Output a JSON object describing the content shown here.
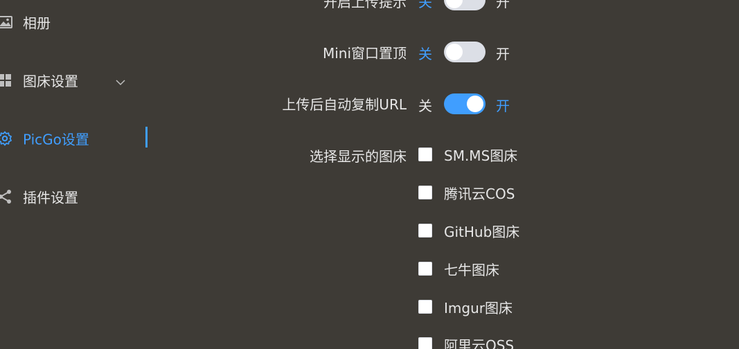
{
  "sidebar": {
    "items": [
      {
        "label": "相册",
        "icon": "image-icon"
      },
      {
        "label": "图床设置",
        "icon": "grid-icon"
      },
      {
        "label": "PicGo设置",
        "icon": "gear-icon"
      },
      {
        "label": "插件设置",
        "icon": "share-icon"
      }
    ]
  },
  "settings": {
    "upload_notice": {
      "label": "开启上传提示",
      "off": "关",
      "on": "开",
      "enabled": false
    },
    "mini_top": {
      "label": "Mini窗口置顶",
      "off": "关",
      "on": "开",
      "enabled": false
    },
    "auto_copy": {
      "label": "上传后自动复制URL",
      "off": "关",
      "on": "开",
      "enabled": true
    },
    "show_hosts": {
      "label": "选择显示的图床",
      "options": [
        "SM.MS图床",
        "腾讯云COS",
        "GitHub图床",
        "七牛图床",
        "Imgur图床",
        "阿里云OSS"
      ]
    }
  },
  "colors": {
    "accent": "#409eff",
    "background": "#3e3b36"
  }
}
